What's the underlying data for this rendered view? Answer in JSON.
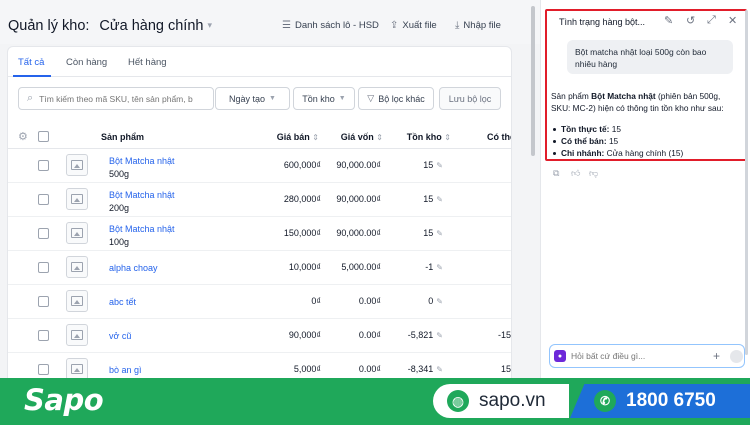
{
  "header": {
    "title": "Quản lý kho:",
    "store": "Cửa hàng chính",
    "actions": [
      "Danh sách lô - HSD",
      "Xuất file",
      "Nhập file"
    ]
  },
  "tabs": [
    "Tất cả",
    "Còn hàng",
    "Hết hàng"
  ],
  "filters": {
    "search_placeholder": "Tìm kiếm theo mã SKU, tên sản phẩm, b",
    "created_date": "Ngày tạo",
    "stock": "Tồn kho",
    "more": "Bộ lọc khác",
    "save": "Lưu bộ lọc"
  },
  "table": {
    "columns": [
      "Sản phẩm",
      "Giá bán",
      "Giá vốn",
      "Tồn kho",
      "Có thể"
    ],
    "rows": [
      {
        "name": "Bột Matcha nhật",
        "variant": "500g",
        "price": "600,000₫",
        "cost": "90,000.00₫",
        "stock": "15",
        "avail": ""
      },
      {
        "name": "Bột Matcha nhật",
        "variant": "200g",
        "price": "280,000₫",
        "cost": "90,000.00₫",
        "stock": "15",
        "avail": ""
      },
      {
        "name": "Bột Matcha nhật",
        "variant": "100g",
        "price": "150,000₫",
        "cost": "90,000.00₫",
        "stock": "15",
        "avail": ""
      },
      {
        "name": "alpha choay",
        "variant": "",
        "price": "10,000₫",
        "cost": "5,000.00₫",
        "stock": "-1",
        "avail": ""
      },
      {
        "name": "abc tết",
        "variant": "",
        "price": "0₫",
        "cost": "0.00₫",
        "stock": "0",
        "avail": ""
      },
      {
        "name": "vở cũ",
        "variant": "",
        "price": "90,000₫",
        "cost": "0.00₫",
        "stock": "-5,821",
        "avail": "-15"
      },
      {
        "name": "bò an gì",
        "variant": "",
        "price": "5,000₫",
        "cost": "0.00₫",
        "stock": "-8,341",
        "avail": "15"
      }
    ]
  },
  "chat": {
    "title": "Tình trạng hàng bột...",
    "question": "Bột matcha nhật loại 500g còn bao nhiêu hàng",
    "answer_pre": "Sản phẩm ",
    "answer_bold": "Bột Matcha nhật",
    "answer_post": " (phiên bản 500g, SKU: MC-2) hiện có thông tin tồn kho như sau:",
    "facts": [
      {
        "label": "Tồn thực tế:",
        "value": " 15"
      },
      {
        "label": "Có thể bán:",
        "value": " 15"
      },
      {
        "label": "Chi nhánh:",
        "value": " Cửa hàng chính (15)"
      }
    ],
    "input_placeholder": "Hỏi bất cứ điều gì..."
  },
  "banner": {
    "brand": "Sapo",
    "website": "sapo.vn",
    "hotline": "1800 6750"
  },
  "colors": {
    "accent": "#2563eb",
    "banner_green": "#1fa85a",
    "hotline_blue": "#1d6fd8",
    "highlight_red": "#e11d2a"
  }
}
